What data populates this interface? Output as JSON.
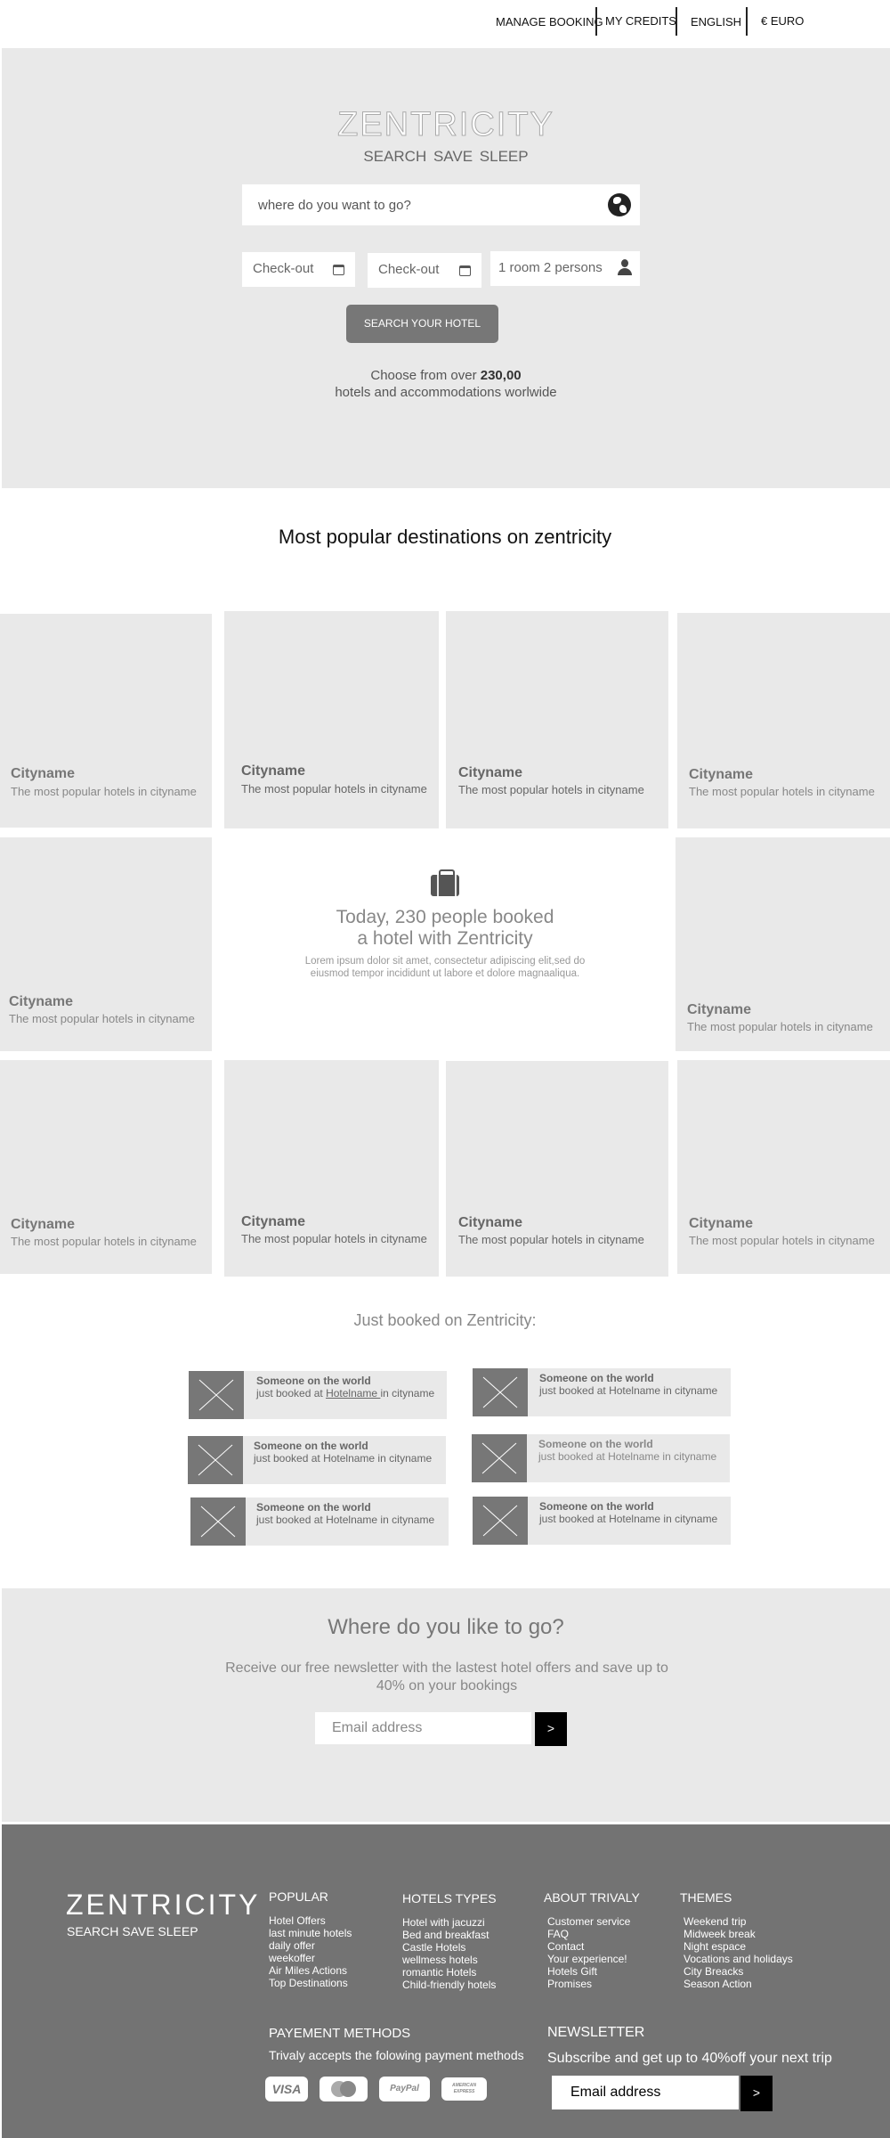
{
  "nav": {
    "manage_booking": "MANAGE BOOKING",
    "my_credits": "MY CREDITS",
    "language": "ENGLISH",
    "currency": "€ EURO"
  },
  "hero": {
    "logo": "ZENTRICITY",
    "tagline": "SEARCH  SAVE SLEEP",
    "search_placeholder": "where do you want to go?",
    "checkin_label": "Check-out",
    "checkout_label": "Check-out",
    "guests_label": "1 room 2 persons",
    "search_button": "SEARCH YOUR HOTEL",
    "choose_prefix": "Choose from over ",
    "choose_count": "230,00",
    "choose_suffix": "hotels and accommodations worlwide"
  },
  "popular": {
    "title": "Most popular destinations on zentricity",
    "tiles": [
      {
        "name": "Cityname",
        "desc": "The most popular hotels in cityname"
      },
      {
        "name": "Cityname",
        "desc": "The most popular hotels in cityname"
      },
      {
        "name": "Cityname",
        "desc": "The most popular hotels in cityname"
      },
      {
        "name": "Cityname",
        "desc": "The most popular hotels in cityname"
      },
      {
        "name": "Cityname",
        "desc": "The most popular hotels in cityname"
      },
      {
        "name": "Cityname",
        "desc": "The most popular hotels in cityname"
      },
      {
        "name": "Cityname",
        "desc": "The most popular hotels in cityname"
      },
      {
        "name": "Cityname",
        "desc": "The most popular hotels in cityname"
      },
      {
        "name": "Cityname",
        "desc": "The most popular hotels in cityname"
      },
      {
        "name": "Cityname",
        "desc": "The most popular hotels in cityname"
      }
    ],
    "booked_line1": "Today, 230 people booked",
    "booked_line2": "a hotel with Zentricity",
    "booked_lorem": "Lorem ipsum dolor sit amet, consectetur adipiscing elit,sed do eiusmod tempor incididunt ut labore et dolore magnaaliqua."
  },
  "just_booked": {
    "title": "Just booked on Zentricity:",
    "cards": [
      {
        "who": "Someone on the world",
        "pre": "just booked at ",
        "hotel": "Hotelname ",
        "post": "in cityname"
      },
      {
        "who": "Someone on the world",
        "pre": "just booked at ",
        "hotel": "Hotelname",
        "post": " in cityname"
      },
      {
        "who": "Someone on the world",
        "pre": "just booked at ",
        "hotel": "Hotelname",
        "post": " in cityname"
      },
      {
        "who": "Someone on the world",
        "pre": "just booked at ",
        "hotel": "Hotelname",
        "post": " in cityname"
      },
      {
        "who": "Someone on the world",
        "pre": "just booked at ",
        "hotel": "Hotelname",
        "post": " in cityname"
      },
      {
        "who": "Someone on the world",
        "pre": "just booked at ",
        "hotel": "Hotelname",
        "post": " in cityname"
      }
    ]
  },
  "newsletter": {
    "title": "Where do you like to go?",
    "text": "Receive our free newsletter with the lastest hotel offers and save up to 40% on your bookings",
    "email_placeholder": "Email address",
    "submit": ">"
  },
  "footer": {
    "logo": "ZENTRICITY",
    "tagline": "SEARCH SAVE SLEEP",
    "columns": [
      {
        "title": "POPULAR",
        "links": [
          "Hotel Offers",
          "last minute hotels",
          "daily offer",
          "weekoffer",
          "Air Miles Actions",
          "Top Destinations"
        ]
      },
      {
        "title": "HOTELS TYPES",
        "links": [
          "Hotel with jacuzzi",
          "Bed and breakfast",
          "Castle Hotels",
          "wellmess hotels",
          "romantic Hotels",
          "Child-friendly hotels"
        ]
      },
      {
        "title": "ABOUT TRIVALY",
        "links": [
          "Customer service",
          "FAQ",
          "Contact",
          "Your experience!",
          "Hotels Gift",
          "Promises"
        ]
      },
      {
        "title": "THEMES",
        "links": [
          "Weekend trip",
          "Midweek break",
          "Night espace",
          "Vocations and holidays",
          "City Breacks",
          "Season Action"
        ]
      }
    ],
    "payment_title": "PAYEMENT METHODS",
    "payment_text": "Trivaly accepts the folowing payment methods",
    "payment_methods": [
      "VISA",
      "",
      "PayPal",
      "AMERICAN EXPRESS"
    ],
    "newsletter_title": "NEWSLETTER",
    "newsletter_text": "Subscribe and get up to 40%off your next trip",
    "email_placeholder": "Email address",
    "submit": ">"
  }
}
